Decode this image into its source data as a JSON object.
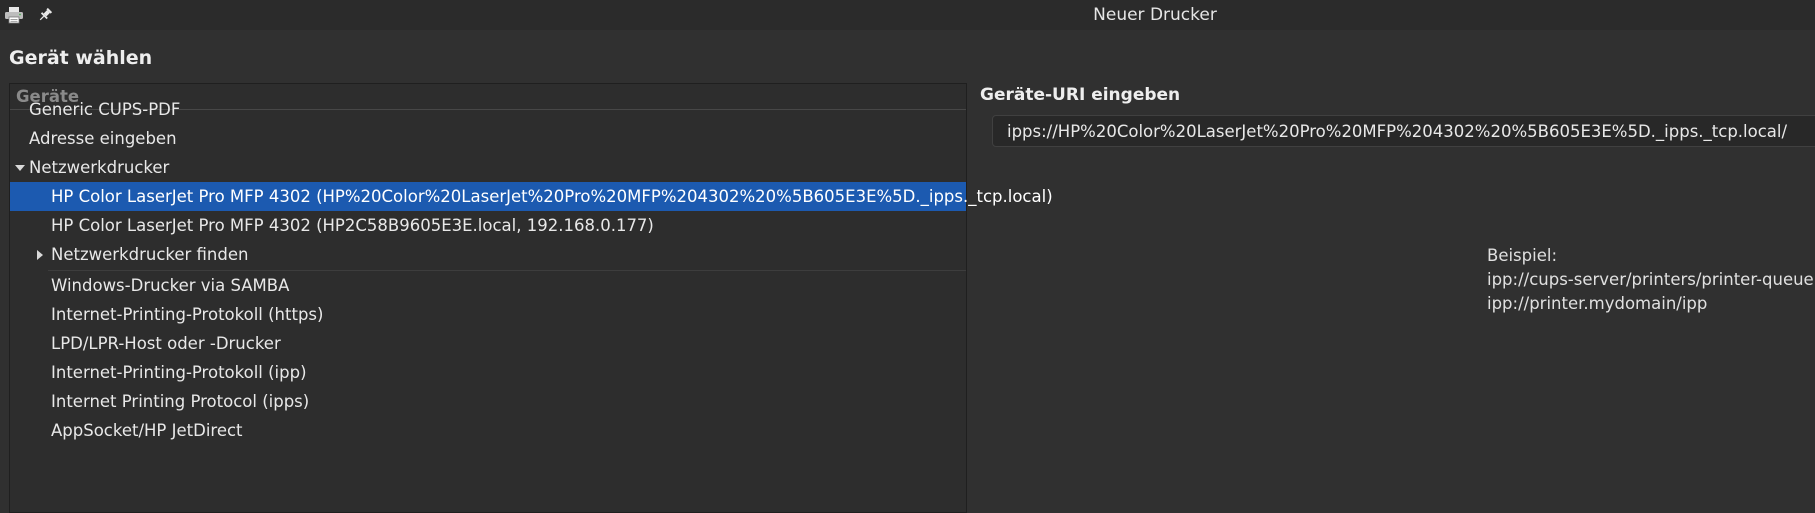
{
  "window": {
    "title": "Neuer Drucker",
    "app_icon": "printer-icon",
    "pin_icon": "pin-icon"
  },
  "page": {
    "heading": "Gerät wählen"
  },
  "device_list": {
    "column_header": "Geräte",
    "items": [
      {
        "label": "Generic CUPS-PDF"
      },
      {
        "label": "Adresse eingeben"
      },
      {
        "label": "Netzwerkdrucker",
        "expanded": true
      },
      {
        "label": "HP Color LaserJet Pro MFP 4302 (HP%20Color%20LaserJet%20Pro%20MFP%204302%20%5B605E3E%5D._ipps._tcp.local)",
        "selected": true
      },
      {
        "label": "HP Color LaserJet Pro MFP 4302 (HP2C58B9605E3E.local, 192.168.0.177)"
      },
      {
        "label": "Netzwerkdrucker finden",
        "expanded": false
      },
      {
        "label": "Windows-Drucker via SAMBA"
      },
      {
        "label": "Internet-Printing-Protokoll (https)"
      },
      {
        "label": "LPD/LPR-Host oder -Drucker"
      },
      {
        "label": "Internet-Printing-Protokoll (ipp)"
      },
      {
        "label": "Internet Printing Protocol (ipps)"
      },
      {
        "label": "AppSocket/HP JetDirect"
      }
    ]
  },
  "uri_panel": {
    "label": "Geräte-URI eingeben",
    "value": "ipps://HP%20Color%20LaserJet%20Pro%20MFP%204302%20%5B605E3E%5D._ipps._tcp.local/",
    "example_title": "Beispiel:",
    "example_lines": [
      "ipp://cups-server/printers/printer-queue",
      "ipp://printer.mydomain/ipp"
    ]
  },
  "colors": {
    "background": "#303030",
    "selection": "#1c5ab0"
  }
}
